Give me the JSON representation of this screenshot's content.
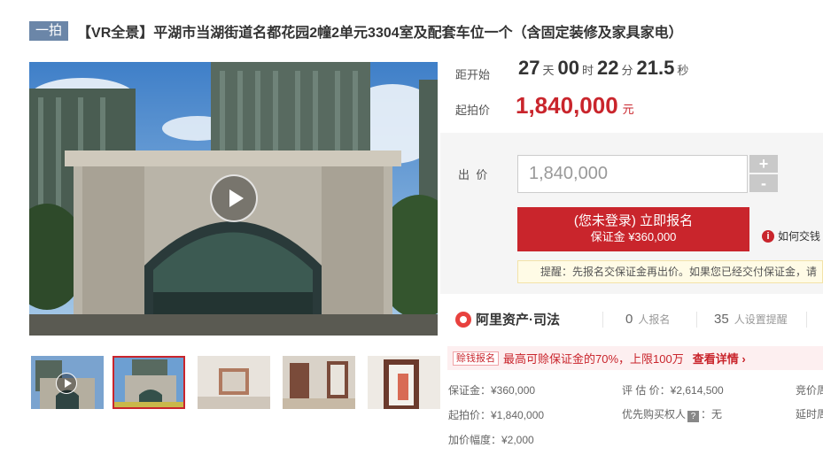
{
  "title": {
    "badge": "一拍",
    "text": "【VR全景】平湖市当湖街道名都花园2幢2单元3304室及配套车位一个（含固定装修及家具家电）"
  },
  "countdown": {
    "label": "距开始",
    "days": "27",
    "days_unit": "天",
    "hours": "00",
    "hours_unit": "时",
    "minutes": "22",
    "minutes_unit": "分",
    "seconds": "21.5",
    "seconds_unit": "秒"
  },
  "start_price": {
    "label": "起拍价",
    "value": "1,840,000",
    "unit": "元"
  },
  "bid": {
    "label": "出  价",
    "input_value": "1,840,000",
    "plus_label": "+",
    "minus_label": "-",
    "signup_line1": "(您未登录) 立即报名",
    "signup_line2": "保证金 ¥360,000",
    "how_icon": "i",
    "how_label": "如何交钱",
    "notice": "提醒：先报名交保证金再出价。如果您已经交付保证金，请"
  },
  "brand": {
    "name": "阿里资产·司法",
    "registered_count": "0",
    "registered_label": "人报名",
    "reminder_count": "35",
    "reminder_label": "人设置提醒"
  },
  "promo": {
    "tag": "赊钱报名",
    "text": "最高可赊保证金的70%，上限100万",
    "link": "查看详情 ›"
  },
  "details": {
    "deposit": "保证金：¥360,000",
    "start": "起拍价：¥1,840,000",
    "increment": "加价幅度：¥2,000",
    "appraisal": "评 估 价：¥2,614,500",
    "priority_label": "优先购买权人",
    "priority_icon": "?",
    "priority_value": "：无",
    "auction_cycle": "竞价周",
    "delay": "延时周"
  },
  "colors": {
    "accent": "#c9252c",
    "badge": "#6b86a8"
  },
  "icons": {
    "play": "play-icon",
    "info": "info-icon",
    "brand": "alibaba-asset-logo"
  }
}
